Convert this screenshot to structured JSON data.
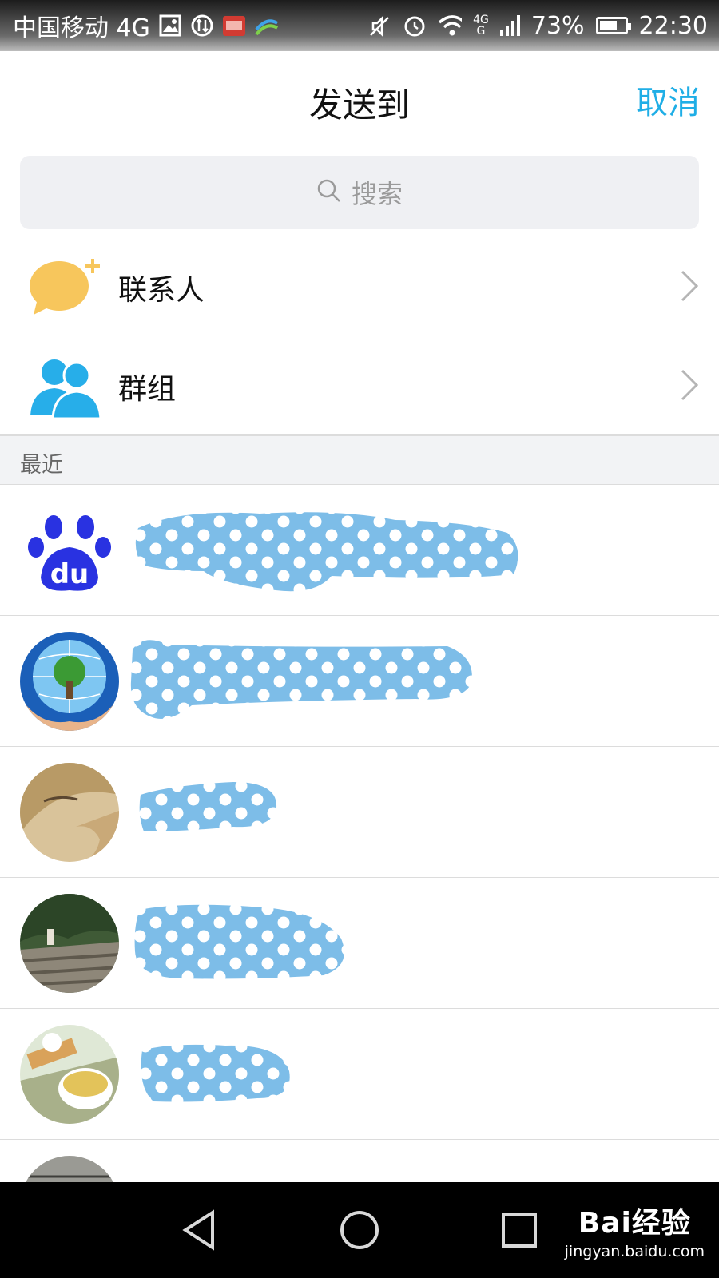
{
  "status_bar": {
    "carrier": "中国移动 4G",
    "network_top": "4G",
    "network_bottom": "G",
    "battery_level_percent": 73,
    "battery": "73%",
    "time": "22:30"
  },
  "header": {
    "title": "发送到",
    "cancel_label": "取消"
  },
  "search": {
    "placeholder": "搜索"
  },
  "menu": [
    {
      "label": "联系人",
      "icon": "chat-bubble-add-icon"
    },
    {
      "label": "群组",
      "icon": "group-icon"
    }
  ],
  "recent": {
    "section_label": "最近",
    "contacts": [
      {
        "avatar": "baidu-paw-logo",
        "name_redacted": true
      },
      {
        "avatar": "globe-tree-hands",
        "name_redacted": true
      },
      {
        "avatar": "face-photo",
        "name_redacted": true
      },
      {
        "avatar": "stone-steps-photo",
        "name_redacted": true
      },
      {
        "avatar": "tea-cup-photo",
        "name_redacted": true
      },
      {
        "avatar": "partial-photo",
        "name_redacted": true
      }
    ]
  },
  "nav_bar": {
    "buttons": [
      "back-icon",
      "home-icon",
      "recents-icon"
    ]
  },
  "watermark": {
    "main": "Bai经验",
    "sub": "jingyan.baidu.com"
  },
  "colors": {
    "accent": "#1faee6",
    "redaction": "#7dbde8",
    "chat_icon": "#f7c65c",
    "group_icon": "#27aee9"
  }
}
